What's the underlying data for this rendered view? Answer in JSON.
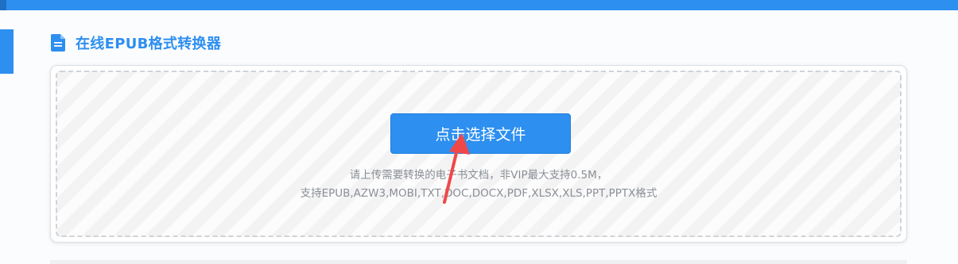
{
  "header": {
    "color": "#2d8ff0"
  },
  "title": {
    "icon": "document-icon",
    "text": "在线EPUB格式转换器"
  },
  "upload": {
    "button_label": "点击选择文件",
    "hint_line1": "请上传需要转换的电子书文档，非VIP最大支持0.5M，",
    "hint_line2": "支持EPUB,AZW3,MOBI,TXT,DOC,DOCX,PDF,XLSX,XLS,PPT,PPTX格式"
  },
  "annotation": {
    "icon": "red-arrow-icon",
    "color": "#f04848"
  }
}
